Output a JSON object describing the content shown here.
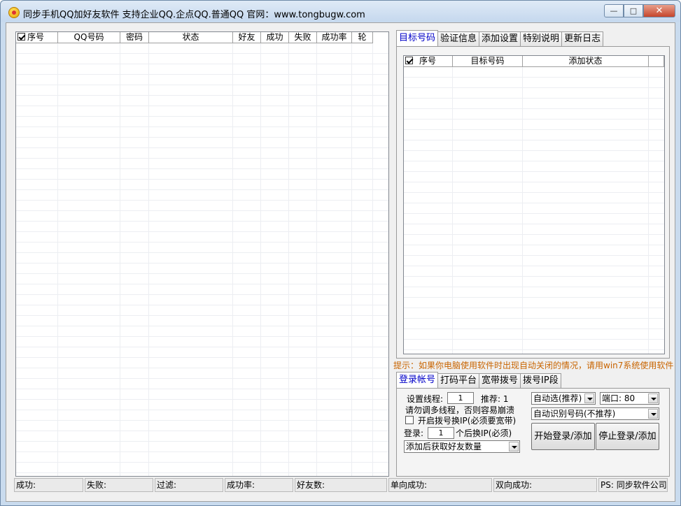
{
  "window": {
    "title": "同步手机QQ加好友软件 支持企业QQ.企点QQ.普通QQ 官网：www.tongbugw.com",
    "min_glyph": "—",
    "max_glyph": "□",
    "close_glyph": "✕"
  },
  "account_grid": {
    "columns": [
      "序号",
      "QQ号码",
      "密码",
      "状态",
      "好友",
      "成功",
      "失败",
      "成功率",
      "轮"
    ]
  },
  "top_tabs": [
    "目标号码",
    "验证信息",
    "添加设置",
    "特别说明",
    "更新日志"
  ],
  "target_grid": {
    "columns": [
      "序号",
      "目标号码",
      "添加状态"
    ]
  },
  "hint": "提示：如果你电脑使用软件时出现自动关闭的情况，请用win7系统使用软件",
  "bottom_tabs": [
    "登录帐号",
    "打码平台",
    "宽带拨号",
    "拨号IP段"
  ],
  "login": {
    "threads_label": "设置线程:",
    "threads_value": "1",
    "recommend_label": "推荐: 1",
    "warning": "请勿调多线程，否则容易崩溃",
    "dial_ip_label": "开启拨号换IP(必须要宽带)",
    "login_label": "登录:",
    "login_value": "1",
    "login_suffix": "个后换IP(必须)",
    "after_add_option": "添加后获取好友数量",
    "auto_select_option": "自动选(推荐)",
    "port_option": "端口: 80",
    "auto_recognize_option": "自动识别号码(不推荐)",
    "start_button": "开始登录/添加",
    "stop_button": "停止登录/添加"
  },
  "status": {
    "success": "成功:",
    "fail": "失败:",
    "filter": "过滤:",
    "rate": "成功率:",
    "friends": "好友数:",
    "one_way": "单向成功:",
    "two_way": "双向成功:",
    "ps": "PS: 同步软件公司"
  }
}
